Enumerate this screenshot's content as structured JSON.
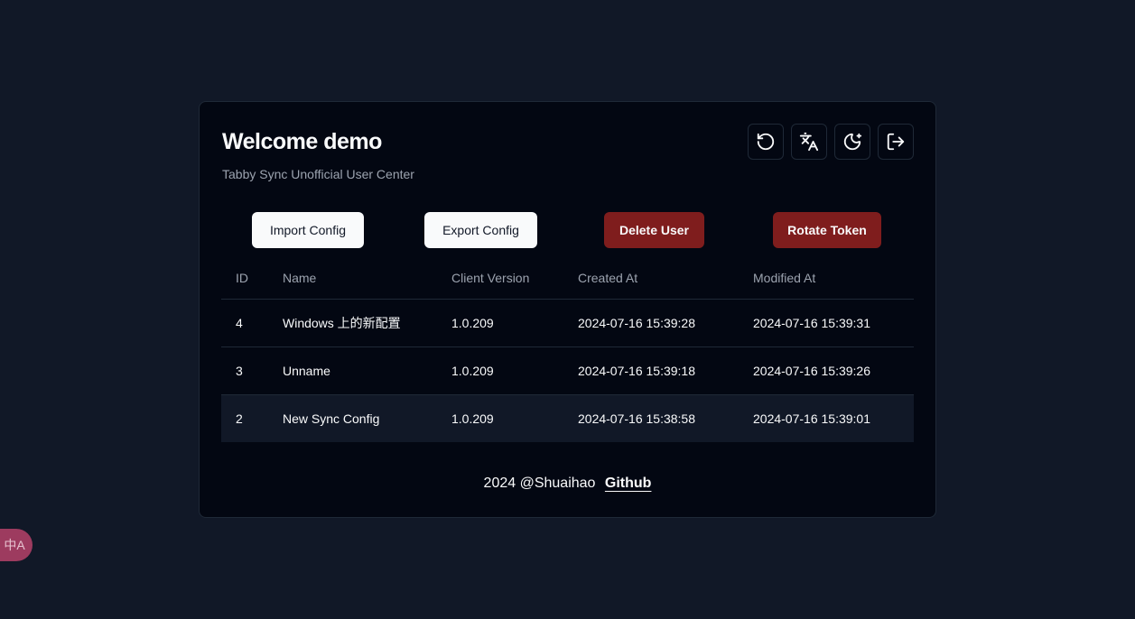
{
  "header": {
    "title": "Welcome demo",
    "subtitle": "Tabby Sync Unofficial User Center"
  },
  "toolbar": {
    "icons": [
      "refresh-icon",
      "translate-icon",
      "theme-moon-icon",
      "logout-icon"
    ]
  },
  "actions": {
    "import_label": "Import Config",
    "export_label": "Export Config",
    "delete_label": "Delete User",
    "rotate_label": "Rotate Token"
  },
  "table": {
    "columns": [
      "ID",
      "Name",
      "Client Version",
      "Created At",
      "Modified At"
    ],
    "rows": [
      [
        "4",
        "Windows 上的新配置",
        "1.0.209",
        "2024-07-16 15:39:28",
        "2024-07-16 15:39:31"
      ],
      [
        "3",
        "Unname",
        "1.0.209",
        "2024-07-16 15:39:18",
        "2024-07-16 15:39:26"
      ],
      [
        "2",
        "New Sync Config",
        "1.0.209",
        "2024-07-16 15:38:58",
        "2024-07-16 15:39:01"
      ]
    ]
  },
  "footer": {
    "text": "2024 @Shuaihao",
    "link": "Github"
  },
  "widget": {
    "label": "中A"
  },
  "colors": {
    "background": "#111827",
    "card": "#030712",
    "danger": "#7f1d1d"
  }
}
